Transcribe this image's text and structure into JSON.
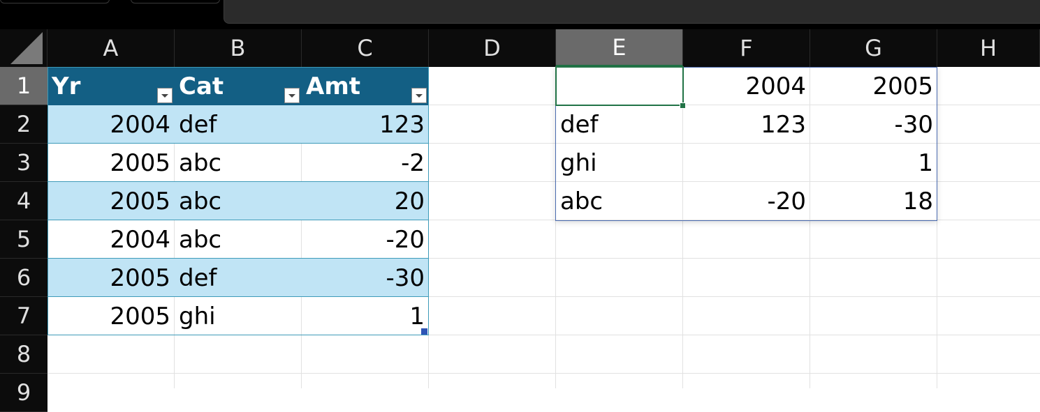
{
  "columns": [
    "A",
    "B",
    "C",
    "D",
    "E",
    "F",
    "G",
    "H"
  ],
  "rows": [
    "1",
    "2",
    "3",
    "4",
    "5",
    "6",
    "7",
    "8",
    "9"
  ],
  "selected_column": "E",
  "selected_row": "1",
  "table": {
    "headers": [
      "Yr",
      "Cat",
      "Amt"
    ],
    "rows": [
      [
        "2004",
        "def",
        "123"
      ],
      [
        "2005",
        "abc",
        "-2"
      ],
      [
        "2005",
        "abc",
        "20"
      ],
      [
        "2004",
        "abc",
        "-20"
      ],
      [
        "2005",
        "def",
        "-30"
      ],
      [
        "2005",
        "ghi",
        "1"
      ]
    ]
  },
  "pivot": {
    "corner": "",
    "col_headers": [
      "2004",
      "2005"
    ],
    "rows": [
      {
        "label": "def",
        "values": [
          "123",
          "-30"
        ]
      },
      {
        "label": "ghi",
        "values": [
          "",
          "1"
        ]
      },
      {
        "label": "abc",
        "values": [
          "-20",
          "18"
        ]
      }
    ]
  },
  "colors": {
    "table_header": "#135f84",
    "band": "#c0e4f5",
    "selection": "#217346"
  }
}
